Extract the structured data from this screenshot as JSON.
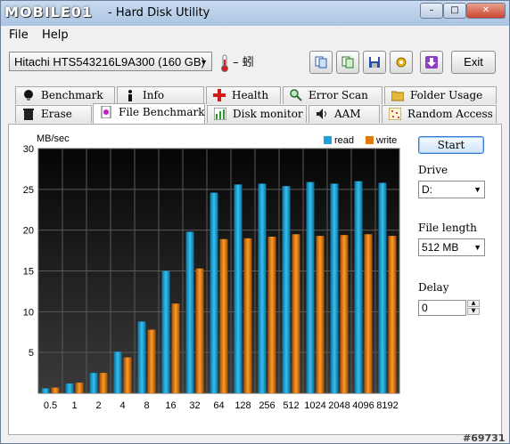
{
  "window": {
    "brand": "MOBILE01",
    "title": "- Hard Disk Utility",
    "controls": {
      "minimize": "–",
      "maximize": "□",
      "close": "✕"
    }
  },
  "menu": {
    "file": "File",
    "help": "Help"
  },
  "toolbar": {
    "drive_select": "Hitachi HTS543216L9A300 (160 GB)",
    "temperature": "– 蚓",
    "exit_label": "Exit",
    "icons": [
      "copy-icon",
      "copy-info-icon",
      "save-icon",
      "options-icon",
      "download-icon"
    ]
  },
  "tabs_top": [
    "Benchmark",
    "Info",
    "Health",
    "Error Scan",
    "Folder Usage"
  ],
  "tabs_bottom": [
    "Erase",
    "File Benchmark",
    "Disk monitor",
    "AAM",
    "Random Access"
  ],
  "active_tab": "File Benchmark",
  "controls": {
    "start_label": "Start",
    "drive_label": "Drive",
    "drive_value": "D:",
    "file_length_label": "File length",
    "file_length_value": "512 MB",
    "delay_label": "Delay",
    "delay_value": "0"
  },
  "colors": {
    "read": "#1fa3d4",
    "write": "#e07a0c"
  },
  "watermark": "#69731",
  "chart_data": {
    "type": "bar",
    "ylabel": "MB/sec",
    "ylim": [
      0,
      30
    ],
    "yticks": [
      5,
      10,
      15,
      20,
      25,
      30
    ],
    "categories": [
      "0.5",
      "1",
      "2",
      "4",
      "8",
      "16",
      "32",
      "64",
      "128",
      "256",
      "512",
      "1024",
      "2048",
      "4096",
      "8192"
    ],
    "series": [
      {
        "name": "read",
        "values": [
          0.6,
          1.2,
          2.5,
          5.1,
          8.8,
          15.0,
          19.8,
          24.6,
          25.6,
          25.7,
          25.4,
          25.9,
          25.7,
          26.0,
          25.8
        ]
      },
      {
        "name": "write",
        "values": [
          0.7,
          1.3,
          2.5,
          4.4,
          7.8,
          11.0,
          15.3,
          18.9,
          19.0,
          19.2,
          19.5,
          19.3,
          19.4,
          19.5,
          19.3
        ]
      }
    ],
    "legend_position": "top-right",
    "grid": true
  }
}
